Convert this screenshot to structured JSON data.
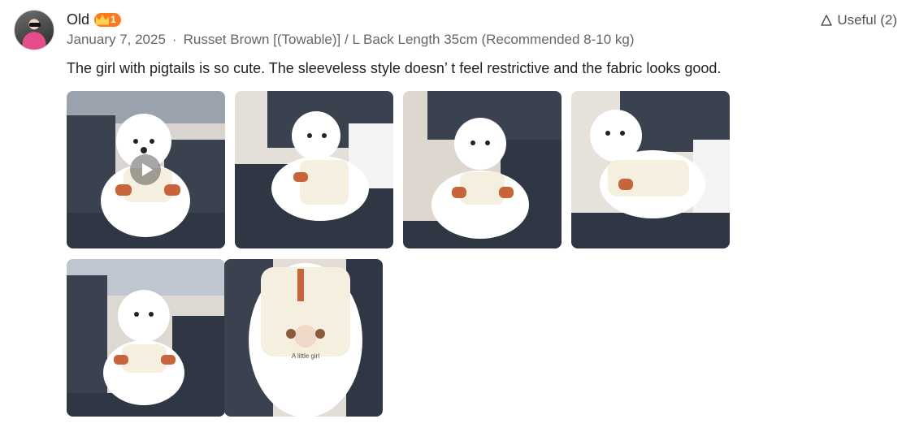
{
  "review": {
    "username": "Old",
    "level": "1",
    "date": "January 7, 2025",
    "separator": "·",
    "variant": "Russet Brown [(Towable)] / L Back Length 35cm (Recommended 8-10 kg)",
    "text": "The girl with pigtails is so cute. The sleeveless style doesn’  t feel restrictive and the fabric looks good.",
    "useful_label": "Useful (2)"
  },
  "photos": [
    {
      "name": "review-video-thumbnail",
      "is_video": true,
      "print": ""
    },
    {
      "name": "review-photo-2",
      "is_video": false,
      "print": ""
    },
    {
      "name": "review-photo-3",
      "is_video": false,
      "print": ""
    },
    {
      "name": "review-photo-4",
      "is_video": false,
      "print": ""
    },
    {
      "name": "review-photo-5",
      "is_video": false,
      "print": ""
    },
    {
      "name": "review-photo-6",
      "is_video": false,
      "print": "A little girl"
    }
  ],
  "colors": {
    "accent_badge": "#ff7a1a",
    "sofa": "#3a4250",
    "dog_fur": "#ffffff",
    "shirt": "#f5efe0",
    "trim": "#c8643a"
  },
  "icons": {
    "avatar": "avatar",
    "level_badge": "crown-icon",
    "useful": "thumb-up-outline-icon",
    "video": "play-icon"
  }
}
